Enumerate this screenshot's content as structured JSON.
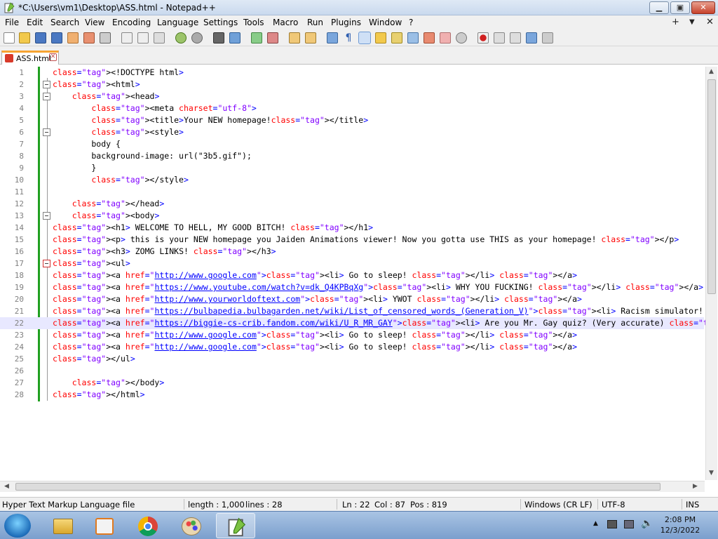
{
  "window": {
    "title": "*C:\\Users\\vm1\\Desktop\\ASS.html - Notepad++",
    "minimize": "▁",
    "maximize": "▣",
    "close": "✕"
  },
  "menu": {
    "items": [
      "File",
      "Edit",
      "Search",
      "View",
      "Encoding",
      "Language",
      "Settings",
      "Tools",
      "Macro",
      "Run",
      "Plugins",
      "Window",
      "?"
    ],
    "right": [
      "+",
      "▼",
      "✕"
    ]
  },
  "tab": {
    "label": "ASS.html",
    "close": "✕"
  },
  "editor": {
    "lines": [
      {
        "n": "1",
        "t": "<!DOCTYPE html>"
      },
      {
        "n": "2",
        "t": "<html>"
      },
      {
        "n": "3",
        "t": "    <head>"
      },
      {
        "n": "4",
        "t": "        <meta charset=\"utf-8\">"
      },
      {
        "n": "5",
        "t": "        <title>Your NEW homepage!</title>"
      },
      {
        "n": "6",
        "t": "        <style>"
      },
      {
        "n": "7",
        "t": "        body {"
      },
      {
        "n": "8",
        "t": "        background-image: url(\"3b5.gif\");"
      },
      {
        "n": "9",
        "t": "        }"
      },
      {
        "n": "10",
        "t": "        </style>"
      },
      {
        "n": "11",
        "t": ""
      },
      {
        "n": "12",
        "t": "    </head>"
      },
      {
        "n": "13",
        "t": "    <body>"
      },
      {
        "n": "14",
        "t": "<h1> WELCOME TO HELL, MY GOOD BITCH! </h1>"
      },
      {
        "n": "15",
        "t": "<p> this is your NEW homepage you Jaiden Animations viewer! Now you gotta use THIS as your homepage! </p>"
      },
      {
        "n": "16",
        "t": "<h3> ZOMG LINKS! </h3>"
      },
      {
        "n": "17",
        "t": "<ul>"
      },
      {
        "n": "18",
        "t": "<a href=\"http://www.google.com\"><li> Go to sleep! </li> </a>"
      },
      {
        "n": "19",
        "t": "<a href=\"https://www.youtube.com/watch?v=dk_Q4KPBqXg\"><li> WHY YOU FUCKING! </li> </a>"
      },
      {
        "n": "20",
        "t": "<a href=\"http://www.yourworldoftext.com\"><li> YWOT </li> </a>"
      },
      {
        "n": "21",
        "t": "<a href=\"https://bulbapedia.bulbagarden.net/wiki/List_of_censored_words_(Generation_V)\"><li> Racism simulator! </li>"
      },
      {
        "n": "22",
        "t": "<a href=\"https://biggie-cs-crib.fandom.com/wiki/U_R_MR_GAY\"><li> Are you Mr. Gay quiz? (Very accurate) </li> </a>"
      },
      {
        "n": "23",
        "t": "<a href=\"http://www.google.com\"><li> Go to sleep! </li> </a>"
      },
      {
        "n": "24",
        "t": "<a href=\"http://www.google.com\"><li> Go to sleep! </li> </a>"
      },
      {
        "n": "25",
        "t": "</ul>"
      },
      {
        "n": "26",
        "t": ""
      },
      {
        "n": "27",
        "t": "    </body>"
      },
      {
        "n": "28",
        "t": "</html>"
      }
    ]
  },
  "status": {
    "filetype": "Hyper Text Markup Language file",
    "length": "length : 1,000",
    "lines": "lines : 28",
    "ln": "Ln : 22",
    "col": "Col : 87",
    "pos": "Pos : 819",
    "eol": "Windows (CR LF)",
    "encoding": "UTF-8",
    "mode": "INS"
  },
  "taskbar": {
    "time": "2:08 PM",
    "date": "12/3/2022"
  }
}
